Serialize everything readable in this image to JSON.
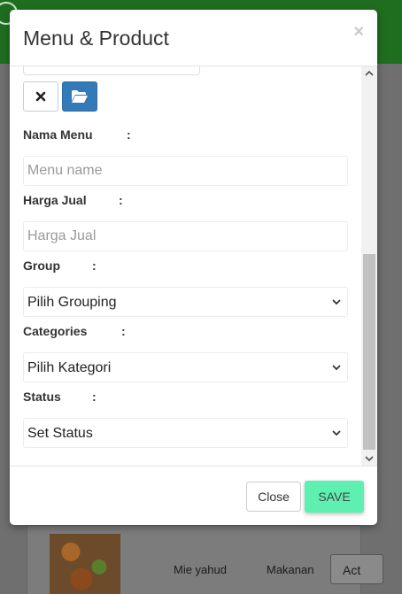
{
  "modal": {
    "title": "Menu & Product",
    "close_symbol": "×"
  },
  "form": {
    "nama_menu": {
      "label": "Nama Menu",
      "colon": ":",
      "placeholder": "Menu name",
      "value": ""
    },
    "harga_jual": {
      "label": "Harga Jual",
      "colon": ":",
      "placeholder": "Harga Jual",
      "value": ""
    },
    "group": {
      "label": "Group",
      "colon": ":",
      "selected": "Pilih Grouping"
    },
    "categories": {
      "label": "Categories",
      "colon": ":",
      "selected": "Pilih Kategori"
    },
    "status": {
      "label": "Status",
      "colon": ":",
      "selected": "Set Status"
    }
  },
  "footer": {
    "close_label": "Close",
    "save_label": "SAVE"
  },
  "background_table": {
    "row": {
      "name": "Mie yahud",
      "category": "Makanan",
      "action_label": "Act"
    }
  },
  "icons": {
    "clear_image": "close-x-icon",
    "browse_image": "folder-open-icon"
  },
  "colors": {
    "save_button": "#5ef0b0",
    "browse_button": "#337ab7",
    "topbar": "#1f6e1f"
  }
}
